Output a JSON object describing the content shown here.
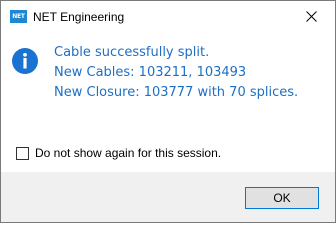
{
  "window": {
    "title": "NET Engineering",
    "app_icon_text": "NET",
    "app_icon": "net-engineering-logo-icon",
    "close_icon": "close-icon"
  },
  "message": {
    "icon": "info-icon",
    "icon_color": "#1a73d0",
    "text_color": "#1e6fc4",
    "lines": [
      "Cable successfully split.",
      "New Cables: 103211, 103493",
      "New Closure: 103777 with 70 splices."
    ]
  },
  "options": {
    "do_not_show_label": "Do not show again for this session.",
    "do_not_show_checked": false
  },
  "buttons": {
    "ok_label": "OK"
  }
}
